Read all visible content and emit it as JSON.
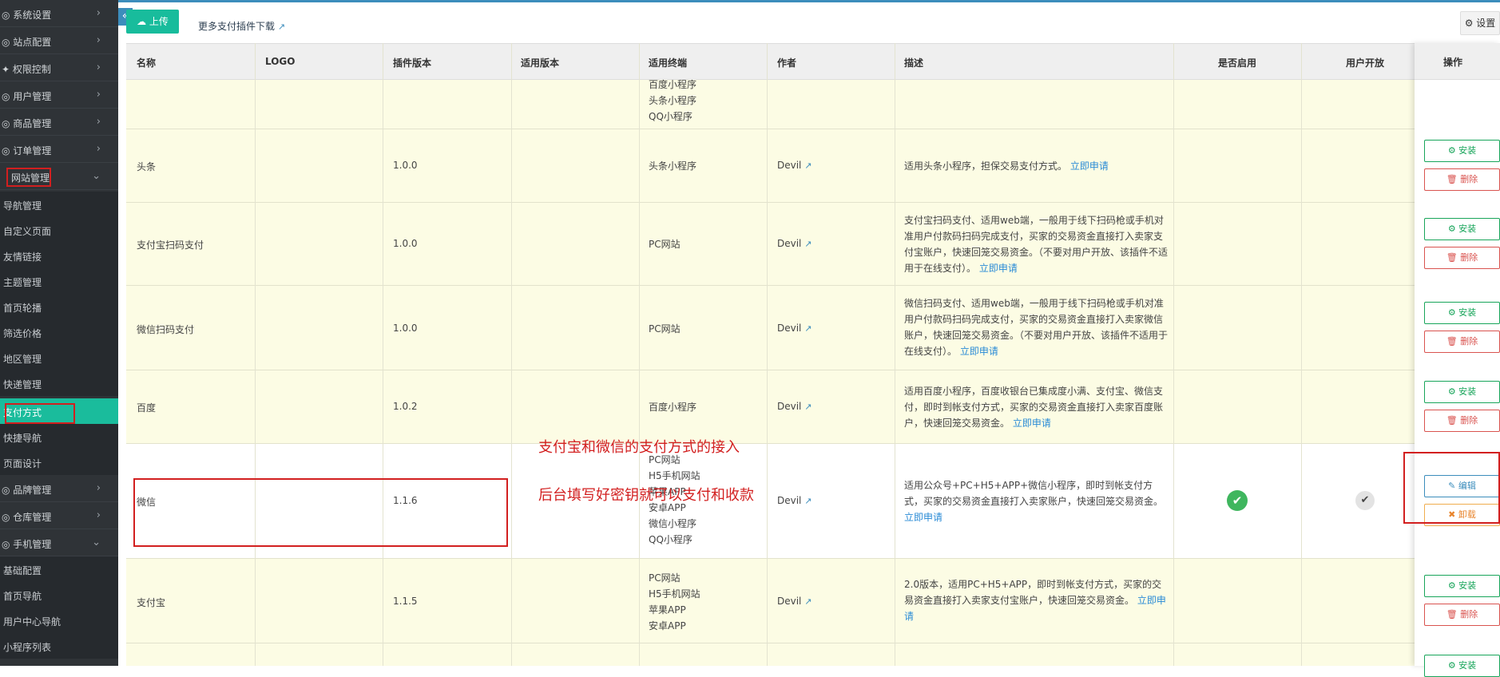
{
  "sidebar": {
    "items": [
      {
        "label": "◎ 系统设置",
        "chev": "›"
      },
      {
        "label": "◎ 站点配置",
        "chev": "›"
      },
      {
        "label": "✦ 权限控制",
        "chev": "›"
      },
      {
        "label": "◎ 用户管理",
        "chev": "›"
      },
      {
        "label": "◎ 商品管理",
        "chev": "›"
      },
      {
        "label": "◎ 订单管理",
        "chev": "›"
      },
      {
        "label": "网站管理",
        "chev": "⌄"
      }
    ],
    "website_sub": [
      "导航管理",
      "自定义页面",
      "友情链接",
      "主题管理",
      "首页轮播",
      "筛选价格",
      "地区管理",
      "快递管理",
      "支付方式",
      "快捷导航",
      "页面设计"
    ],
    "items2": [
      {
        "label": "◎ 品牌管理",
        "chev": "›"
      },
      {
        "label": "◎ 仓库管理",
        "chev": "›"
      },
      {
        "label": "◎ 手机管理",
        "chev": "⌄"
      }
    ],
    "mobile_sub": [
      "基础配置",
      "首页导航",
      "用户中心导航",
      "小程序列表"
    ],
    "collapse_icon": "«"
  },
  "toolbar": {
    "upload_label": "☁ 上传",
    "more_link": "更多支付插件下载",
    "more_link_icon": "↗",
    "settings_label": "⚙ 设置"
  },
  "table": {
    "headers": [
      "名称",
      "LOGO",
      "插件版本",
      "适用版本",
      "适用终端",
      "作者",
      "描述",
      "是否启用",
      "用户开放",
      "操作"
    ],
    "partial_row": {
      "terminals": [
        "百度小程序",
        "头条小程序",
        "QQ小程序"
      ]
    },
    "rows": [
      {
        "name": "头条",
        "version": "1.0.0",
        "terminals": [
          "头条小程序"
        ],
        "author": "Devil",
        "desc": "适用头条小程序，担保交易支付方式。",
        "apply": "立即申请",
        "op1": "⚙ 安装",
        "op2": "🗑 删除"
      },
      {
        "name": "支付宝扫码支付",
        "version": "1.0.0",
        "terminals": [
          "PC网站"
        ],
        "author": "Devil",
        "desc": "支付宝扫码支付、适用web端，一般用于线下扫码枪或手机对准用户付款码扫码完成支付，买家的交易资金直接打入卖家支付宝账户，快速回笼交易资金。（不要对用户开放、该插件不适用于在线支付）。",
        "apply": "立即申请",
        "op1": "⚙ 安装",
        "op2": "🗑 删除"
      },
      {
        "name": "微信扫码支付",
        "version": "1.0.0",
        "terminals": [
          "PC网站"
        ],
        "author": "Devil",
        "desc": "微信扫码支付、适用web端，一般用于线下扫码枪或手机对准用户付款码扫码完成支付，买家的交易资金直接打入卖家微信账户，快速回笼交易资金。（不要对用户开放、该插件不适用于在线支付）。",
        "apply": "立即申请",
        "op1": "⚙ 安装",
        "op2": "🗑 删除"
      },
      {
        "name": "百度",
        "version": "1.0.2",
        "terminals": [
          "百度小程序"
        ],
        "author": "Devil",
        "desc": "适用百度小程序，百度收银台已集成度小满、支付宝、微信支付，即时到帐支付方式，买家的交易资金直接打入卖家百度账户，快速回笼交易资金。",
        "apply": "立即申请",
        "op1": "⚙ 安装",
        "op2": "🗑 删除"
      },
      {
        "name": "微信",
        "version": "1.1.6",
        "terminals": [
          "PC网站",
          "H5手机网站",
          "苹果APP",
          "安卓APP",
          "微信小程序",
          "QQ小程序"
        ],
        "author": "Devil",
        "desc": "适用公众号+PC+H5+APP+微信小程序，即时到帐支付方式，买家的交易资金直接打入卖家账户，快速回笼交易资金。",
        "apply": "立即申请",
        "op1": "✎ 编辑",
        "op2": "✖ 卸载"
      },
      {
        "name": "支付宝",
        "version": "1.1.5",
        "terminals": [
          "PC网站",
          "H5手机网站",
          "苹果APP",
          "安卓APP"
        ],
        "author": "Devil",
        "desc": "2.0版本，适用PC+H5+APP，即时到帐支付方式，买家的交易资金直接打入卖家支付宝账户，快速回笼交易资金。",
        "apply": "立即申请",
        "op1": "⚙ 安装",
        "op2": "🗑 删除"
      }
    ],
    "last_row_op": "⚙ 安装",
    "enabled_icon": "✔",
    "open_icon": "✔",
    "ext_icon": "↗"
  },
  "annotations": {
    "line1": "支付宝和微信的支付方式的接入",
    "line2": "后台填写好密钥就可以支付和收款"
  },
  "colors": {
    "sidebar": "#2f3337",
    "accent": "#18bc9c",
    "row": "#fcfce4",
    "annotation": "#d21f1f"
  }
}
